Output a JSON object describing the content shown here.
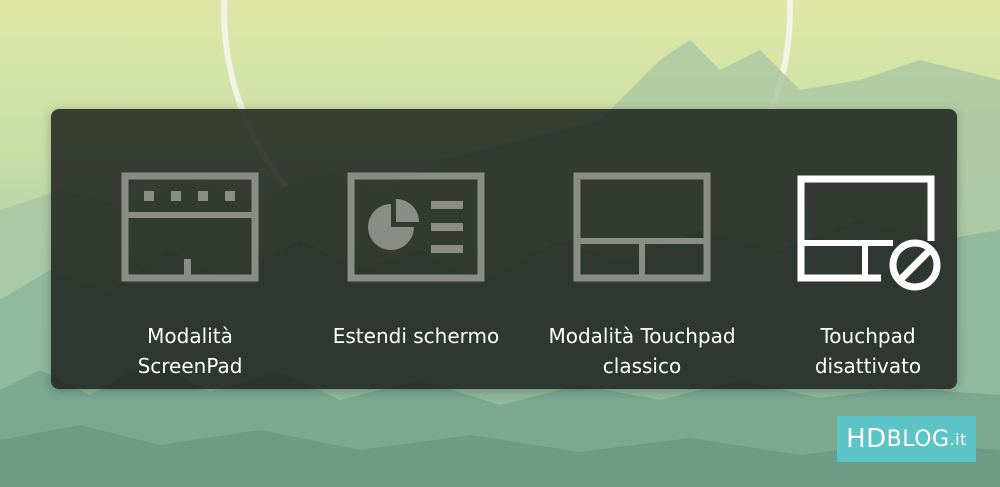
{
  "osd": {
    "options": [
      {
        "line1": "Modalità",
        "line2": "ScreenPad",
        "icon": "screenpad-mode-icon",
        "selected": false
      },
      {
        "line1": "Estendi schermo",
        "line2": "",
        "icon": "extend-screen-icon",
        "selected": false
      },
      {
        "line1": "Modalità Touchpad",
        "line2": "classico",
        "icon": "classic-touchpad-icon",
        "selected": false
      },
      {
        "line1": "Touchpad",
        "line2": "disattivato",
        "icon": "touchpad-disabled-icon",
        "selected": true
      }
    ]
  },
  "watermark": {
    "hd": "HD",
    "blog": "BLOG",
    "tld": ".it"
  },
  "colors": {
    "panel_bg": "#1e221e",
    "icon_inactive": "#8a8c88",
    "icon_active": "#ffffff",
    "label": "#ffffff",
    "watermark_bg": "#5cc3c7"
  }
}
